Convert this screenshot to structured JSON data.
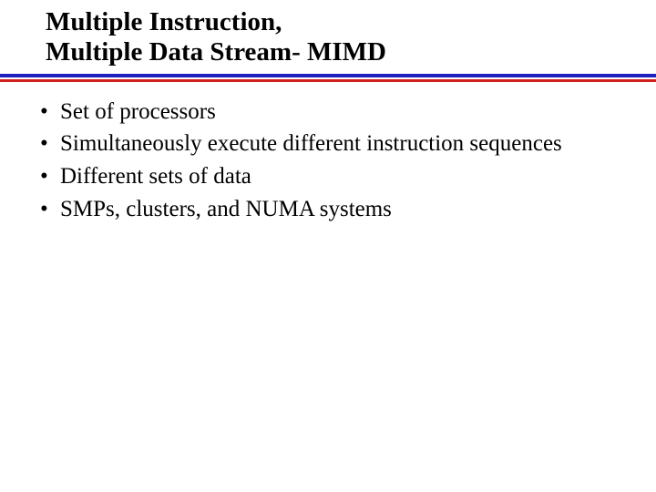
{
  "title": {
    "line1": "Multiple Instruction,",
    "line2": " Multiple Data Stream- MIMD"
  },
  "bullets": {
    "item0": "Set of processors",
    "item1": "Simultaneously execute different instruction sequences",
    "item2": "Different sets of data",
    "item3": "SMPs, clusters, and NUMA systems"
  }
}
